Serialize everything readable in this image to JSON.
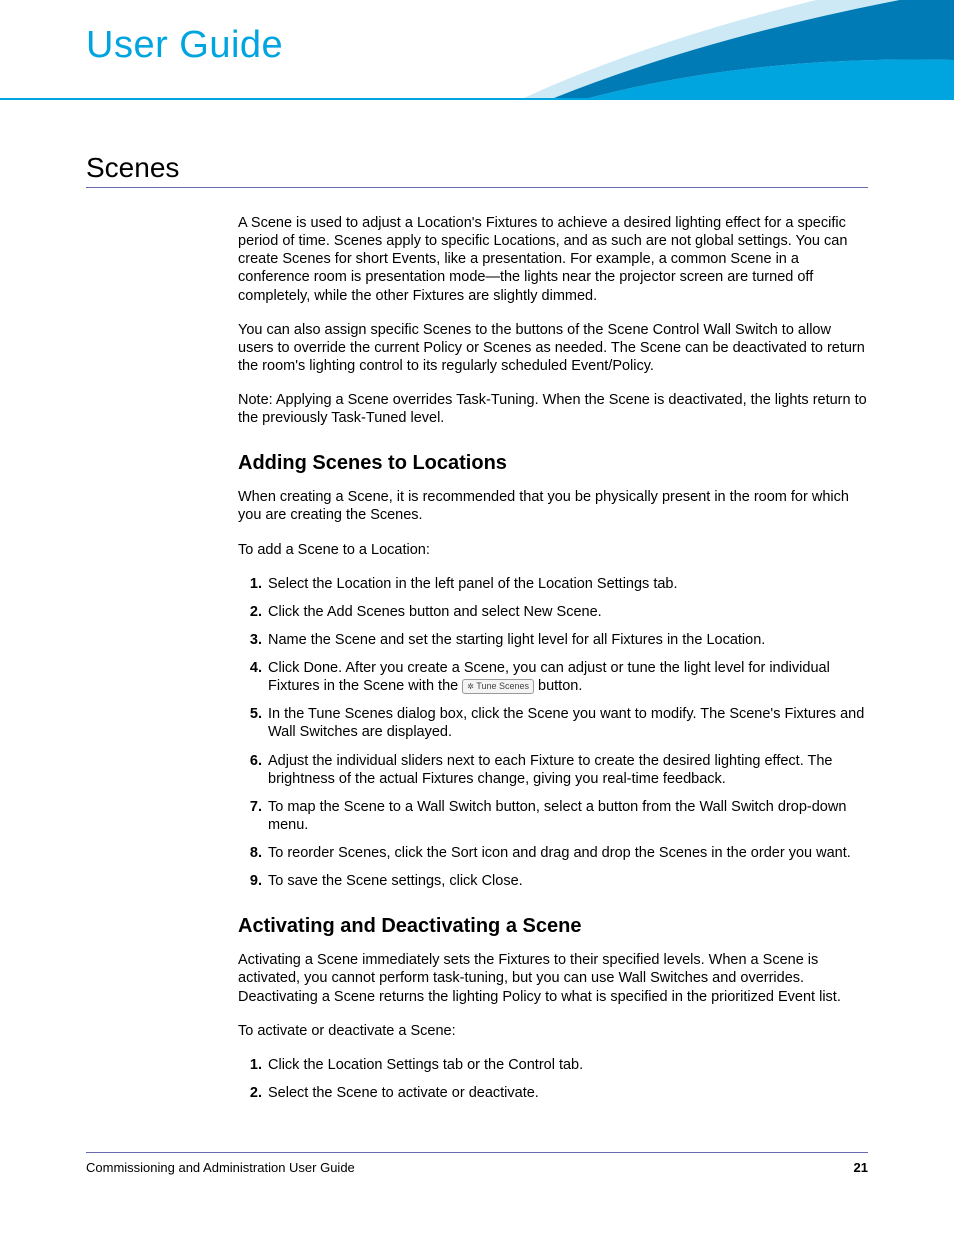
{
  "header": {
    "title": "User Guide"
  },
  "section": {
    "title": "Scenes"
  },
  "intro": {
    "p1": "A Scene is used to adjust a Location's Fixtures to achieve a desired lighting effect for a specific period of time. Scenes apply to specific Locations, and as such are not global settings. You can create Scenes for short Events, like a presentation. For example, a common Scene in a conference room is presentation mode—the lights near the projector screen are turned off completely, while the other Fixtures are slightly dimmed.",
    "p2": "You can also assign specific Scenes to the buttons of the Scene Control Wall Switch to allow users to override the current Policy or Scenes as needed. The Scene can be deactivated to return the room's lighting control to its regularly scheduled Event/Policy.",
    "p3": "Note: Applying a Scene overrides Task-Tuning. When the Scene is deactivated, the lights return to the previously Task-Tuned level."
  },
  "adding": {
    "heading": "Adding Scenes to Locations",
    "intro": "When creating a Scene, it is recommended that you be physically present in the room for which you are creating the Scenes.",
    "preamble": "To add a Scene to a Location:",
    "steps": {
      "s1": "Select the Location in the left panel of the Location Settings tab.",
      "s2": "Click the Add Scenes button and select New Scene.",
      "s3": "Name the Scene and set the starting light level for all Fixtures in the Location.",
      "s4a": "Click Done. After you create a Scene, you can adjust or tune the light level for individual Fixtures in the Scene with the ",
      "s4_btn": "Tune Scenes",
      "s4b": " button.",
      "s5": "In the Tune Scenes dialog box, click the Scene you want to modify. The Scene's Fixtures and Wall Switches are displayed.",
      "s6": "Adjust the individual sliders next to each Fixture to create the desired lighting effect. The brightness of the actual Fixtures change, giving you real-time feedback.",
      "s7": "To map the Scene to a Wall Switch button, select a button from the Wall Switch drop-down menu.",
      "s8": "To reorder Scenes, click the Sort icon and drag and drop the Scenes in the order you want.",
      "s9": "To save the Scene settings, click Close."
    }
  },
  "activating": {
    "heading": "Activating and Deactivating a Scene",
    "intro": "Activating a Scene immediately sets the Fixtures to their specified levels. When a Scene is activated, you cannot perform task-tuning, but you can use Wall Switches and overrides. Deactivating a Scene returns the lighting Policy to what is specified in the prioritized Event list.",
    "preamble": "To activate or deactivate a Scene:",
    "steps": {
      "s1": "Click the Location Settings tab or the Control tab.",
      "s2": "Select the Scene to activate or deactivate."
    }
  },
  "footer": {
    "doc": "Commissioning and Administration User Guide",
    "page": "21"
  }
}
